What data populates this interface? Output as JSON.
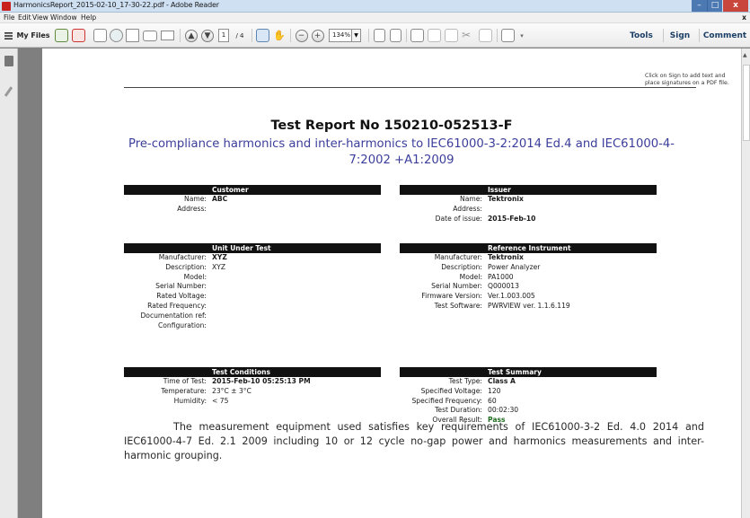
{
  "window": {
    "title": "HarmonicsReport_2015-02-10_17-30-22.pdf - Adobe Reader",
    "minimize": "–",
    "maximize": "□",
    "close": "x"
  },
  "menu": {
    "items": [
      "File",
      "Edit",
      "View",
      "Window",
      "Help"
    ],
    "close_doc": "x"
  },
  "toolbar": {
    "my_files": "My Files",
    "page_current": "1",
    "page_total": "/ 4",
    "zoom": "134%",
    "tools": "Tools",
    "sign": "Sign",
    "comment": "Comment"
  },
  "sign_hint": "Click on Sign to add text and place signatures on a PDF file.",
  "report": {
    "title": "Test Report No 150210-052513-F",
    "subtitle": "Pre-compliance harmonics and inter-harmonics to IEC61000-3-2:2014 Ed.4 and IEC61000-4-7:2002 +A1:2009",
    "customer": {
      "header": "Customer",
      "rows": [
        {
          "label": "Name:",
          "value": "ABC"
        },
        {
          "label": "Address:",
          "value": ""
        }
      ]
    },
    "issuer": {
      "header": "Issuer",
      "rows": [
        {
          "label": "Name:",
          "value": "Tektronix"
        },
        {
          "label": "Address:",
          "value": ""
        },
        {
          "label": "Date of issue:",
          "value": "2015-Feb-10"
        }
      ]
    },
    "uut": {
      "header": "Unit Under Test",
      "rows": [
        {
          "label": "Manufacturer:",
          "value": "XYZ"
        },
        {
          "label": "Description:",
          "value": "XYZ"
        },
        {
          "label": "Model:",
          "value": ""
        },
        {
          "label": "Serial Number:",
          "value": ""
        },
        {
          "label": "Rated Voltage:",
          "value": ""
        },
        {
          "label": "Rated Frequency:",
          "value": ""
        },
        {
          "label": "Documentation ref:",
          "value": ""
        },
        {
          "label": "Configuration:",
          "value": ""
        }
      ]
    },
    "ref": {
      "header": "Reference Instrument",
      "rows": [
        {
          "label": "Manufacturer:",
          "value": "Tektronix"
        },
        {
          "label": "Description:",
          "value": "Power Analyzer"
        },
        {
          "label": "Model:",
          "value": "PA1000"
        },
        {
          "label": "Serial Number:",
          "value": "Q000013"
        },
        {
          "label": "Firmware Version:",
          "value": "Ver.1.003.005"
        },
        {
          "label": "Test Software:",
          "value": "PWRVIEW ver. 1.1.6.119"
        }
      ]
    },
    "conditions": {
      "header": "Test Conditions",
      "rows": [
        {
          "label": "Time of Test:",
          "value": "2015-Feb-10 05:25:13 PM"
        },
        {
          "label": "Temperature:",
          "value": "23°C ± 3°C"
        },
        {
          "label": "Humidity:",
          "value": "< 75"
        }
      ]
    },
    "summary": {
      "header": "Test Summary",
      "rows": [
        {
          "label": "Test Type:",
          "value": "Class A"
        },
        {
          "label": "Specified Voltage:",
          "value": "120"
        },
        {
          "label": "Specified Frequency:",
          "value": "60"
        },
        {
          "label": "Test Duration:",
          "value": "00:02:30"
        },
        {
          "label": "Overall Result:",
          "value": "Pass"
        }
      ]
    },
    "body": "The measurement equipment used satisfies key requirements of IEC61000-3-2 Ed. 4.0 2014 and IEC61000-4-7 Ed. 2.1 2009 including 10 or 12 cycle no-gap power and harmonics measurements and inter-harmonic grouping."
  }
}
